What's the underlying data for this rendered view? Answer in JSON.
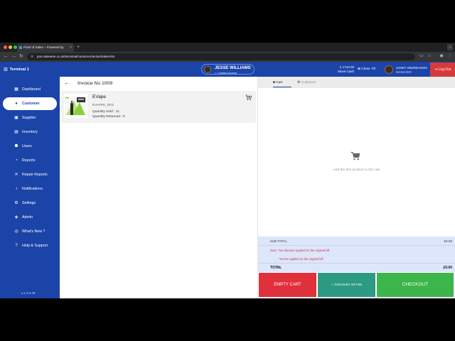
{
  "browser": {
    "tab_title": "Point of Sales – Powered by",
    "tab_close": "×",
    "new_tab": "+",
    "url": "pos.salewise.co.uk/terminal/customer/action/sales-list",
    "back_glyph": "←",
    "forward_glyph": "→",
    "reload_glyph": "↻"
  },
  "header": {
    "terminal_label": "Terminal 1",
    "user_name": "JESSE WILLIAMS",
    "access_label": "Limited Access",
    "cash_amount": "£ 1710.00",
    "move_cash_label": "Move Cash",
    "close_till_label": "Close Till",
    "manager_name": "JANET ANDREASON",
    "manager_role": "MANAGER",
    "logout_label": "Log Out"
  },
  "sidebar": {
    "items": [
      {
        "label": "Dashboard",
        "icon": "dashboard-icon"
      },
      {
        "label": "Customer",
        "icon": "person-icon"
      },
      {
        "label": "Supplier",
        "icon": "truck-icon"
      },
      {
        "label": "Inventory",
        "icon": "inventory-icon"
      },
      {
        "label": "Users",
        "icon": "users-icon"
      },
      {
        "label": "Reports",
        "icon": "reports-icon"
      },
      {
        "label": "Repair Reports",
        "icon": "wrench-icon"
      },
      {
        "label": "Notifications",
        "icon": "bell-icon"
      },
      {
        "label": "Settings",
        "icon": "gear-icon"
      },
      {
        "label": "Admin",
        "icon": "admin-icon"
      },
      {
        "label": "What's New ?",
        "icon": "sparkle-icon"
      },
      {
        "label": "Help & Support",
        "icon": "help-icon"
      }
    ],
    "active": "Customer",
    "version": "v.1.4.0.49"
  },
  "invoice": {
    "title": "Invoice No 1009",
    "product": {
      "name": "EVape",
      "sku": "EVAPPE_DFD",
      "quantity_sold": "Quantity Sold : 11",
      "quantity_returned": "Quantity Returned : 0"
    }
  },
  "cart": {
    "tabs": {
      "cart": "Cart",
      "customer": "Customer"
    },
    "empty_message": "Add the first product to the cart",
    "sub_total_label": "SUB TOTAL",
    "sub_total_value": "£0.00",
    "note_discount": "Note: *No discount applied on the original bill",
    "note_fee": "*No fee applied on the original bill",
    "total_label": "TOTAL",
    "total_value": "£0.00",
    "empty_cart_label": "EMPTY CART",
    "discount_label": "DISCOUNT OR FEE",
    "discount_plus": "+",
    "checkout_label": "CHECKOUT"
  },
  "colors": {
    "brand_blue": "#1b44a8",
    "logout_red": "#d63a3a",
    "empty_red": "#e0303b",
    "discount_teal": "#2d9a83",
    "checkout_green": "#3cb54a",
    "note_red": "#d2334c"
  }
}
